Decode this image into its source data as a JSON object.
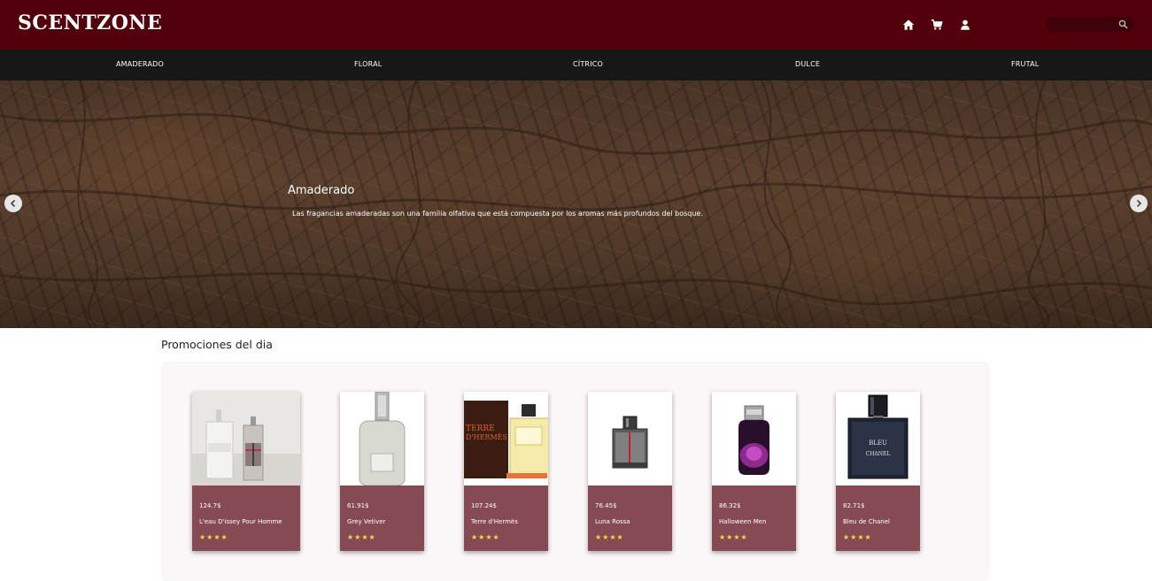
{
  "header": {
    "logo": "SCENTZONE",
    "icons": [
      "home-icon",
      "cart-icon",
      "user-icon"
    ],
    "search": {
      "value": "",
      "placeholder": ""
    }
  },
  "nav": {
    "items": [
      {
        "label": "AMADERADO"
      },
      {
        "label": "FLORAL"
      },
      {
        "label": "CÍTRICO"
      },
      {
        "label": "DULCE"
      },
      {
        "label": "FRUTAL"
      }
    ]
  },
  "hero": {
    "title": "Amaderado",
    "text": "Las fragancias amaderadas son una familia olfativa que está compuesta por los aromas más profundos del bosque."
  },
  "promos": {
    "title": "Promociones del dia",
    "products": [
      {
        "price": "124.7$",
        "name": "L'eau D'issey Pour Homme",
        "rating": 4
      },
      {
        "price": "61.91$",
        "name": "Grey Vetiver",
        "rating": 4
      },
      {
        "price": "107.24$",
        "name": "Terre d'Hermès",
        "rating": 4
      },
      {
        "price": "76.45$",
        "name": "Luna Rossa",
        "rating": 4
      },
      {
        "price": "86.32$",
        "name": "Halloween Men",
        "rating": 4
      },
      {
        "price": "82.71$",
        "name": "Bleu de Chanel",
        "rating": 4
      }
    ],
    "stars_display": "★★★★"
  },
  "colors": {
    "header_bg": "#51000c",
    "nav_bg": "#171717",
    "card_bg": "#864a55",
    "star": "#ffd34d"
  }
}
